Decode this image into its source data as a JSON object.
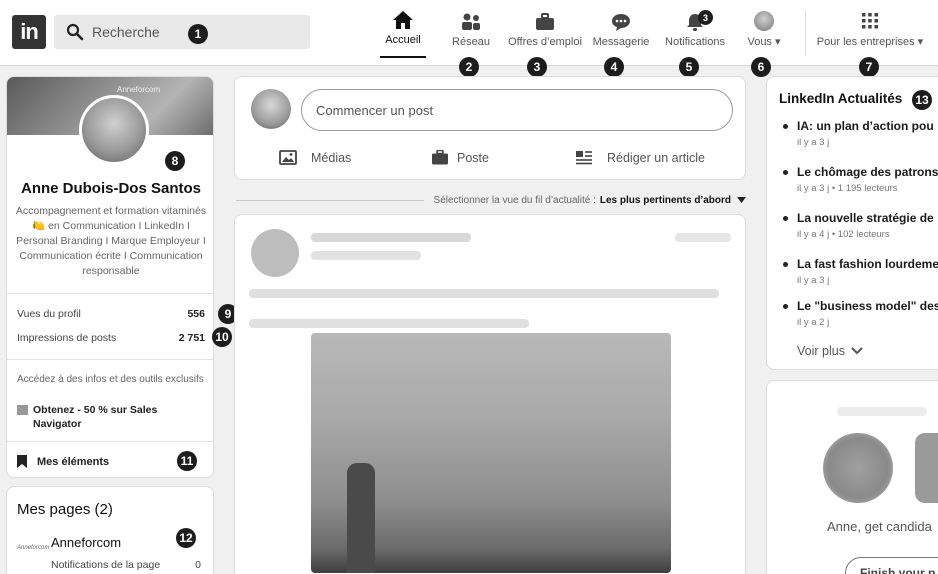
{
  "header": {
    "logo_text": "in",
    "search_placeholder": "Recherche",
    "search_badge": "1",
    "nav": [
      {
        "label": "Accueil",
        "badge": ""
      },
      {
        "label": "Réseau",
        "badge": "2"
      },
      {
        "label": "Offres d’emploi",
        "badge": "3"
      },
      {
        "label": "Messagerie",
        "badge": "4"
      },
      {
        "label": "Notifications",
        "badge": "5",
        "count": "3"
      },
      {
        "label": "Vous",
        "badge": "6"
      },
      {
        "label": "Pour les entreprises",
        "badge": "7"
      }
    ]
  },
  "profile": {
    "banner_text": "Anneforcom",
    "name": "Anne Dubois-Dos Santos",
    "badge": "8",
    "headline": "Accompagnement et formation vitaminés 🍋 en Communication I LinkedIn I Personal Branding I Marque Employeur I Communication écrite I Communication responsable",
    "stats": [
      {
        "label": "Vues du profil",
        "value": "556",
        "badge": "9"
      },
      {
        "label": "Impressions de posts",
        "value": "2 751",
        "badge": "10"
      }
    ],
    "premium_text": "Accédez à des infos et des outils exclusifs",
    "premium_link": "Obtenez - 50 % sur Sales Navigator",
    "my_items": "Mes éléments",
    "my_items_badge": "11"
  },
  "pages": {
    "title": "Mes pages (2)",
    "badge": "12",
    "logo_text": "Anneforcom",
    "name": "Anneforcom",
    "notif_label": "Notifications de la page",
    "notif_value": "0"
  },
  "composer": {
    "placeholder": "Commencer un post",
    "actions": [
      "Médias",
      "Poste",
      "Rédiger un article"
    ]
  },
  "feed_sort": {
    "label": "Sélectionner la vue du fil d’actualité :",
    "value": "Les plus pertinents d’abord"
  },
  "news": {
    "title": "LinkedIn Actualités",
    "badge": "13",
    "items": [
      {
        "title": "IA: un plan d’action pou",
        "meta": "il y a 3 j"
      },
      {
        "title": "Le chômage des patrons",
        "meta": "il y a 3 j • 1 195 lecteurs"
      },
      {
        "title": "La nouvelle stratégie de",
        "meta": "il y a 4 j • 102 lecteurs"
      },
      {
        "title": "La fast fashion lourdeme",
        "meta": "il y a 3 j"
      },
      {
        "title": "Le \"business model\" des",
        "meta": "il y a 2 j"
      }
    ],
    "see_more": "Voir plus"
  },
  "ad": {
    "text": "Anne, get candida",
    "button": "Finish your p"
  }
}
